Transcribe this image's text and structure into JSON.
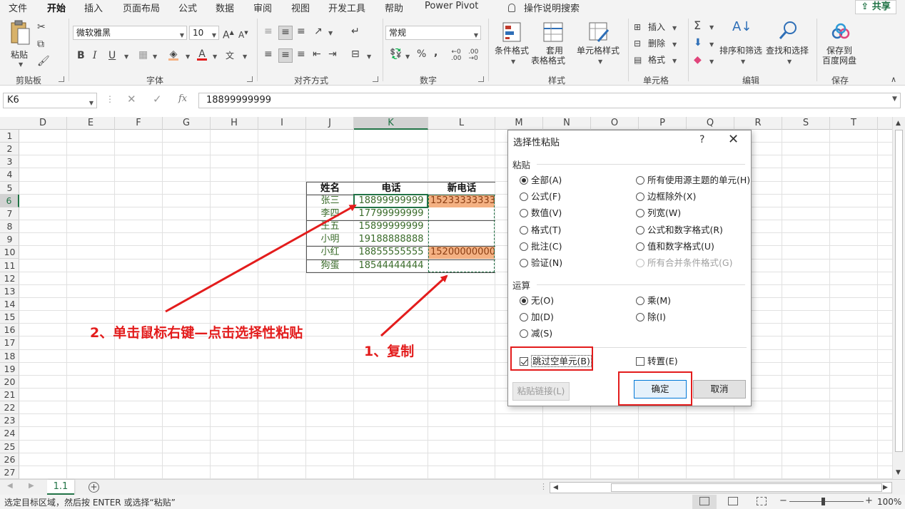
{
  "menu": {
    "tabs": [
      "文件",
      "开始",
      "插入",
      "页面布局",
      "公式",
      "数据",
      "审阅",
      "视图",
      "开发工具",
      "帮助",
      "Power Pivot"
    ],
    "active_tab": "开始",
    "tell_me": "操作说明搜索",
    "share": "共享"
  },
  "ribbon": {
    "clipboard": {
      "label": "剪贴板",
      "paste": "粘贴"
    },
    "font": {
      "label": "字体",
      "font_name": "微软雅黑",
      "font_size": "10"
    },
    "alignment": {
      "label": "对齐方式"
    },
    "number": {
      "label": "数字",
      "format": "常规"
    },
    "styles": {
      "label": "样式",
      "conditional_format": "条件格式",
      "table_format_line1": "套用",
      "table_format_line2": "表格格式",
      "cell_styles": "单元格样式"
    },
    "cells": {
      "label": "单元格",
      "insert": "插入",
      "delete": "删除",
      "format": "格式"
    },
    "editing": {
      "label": "编辑",
      "sort_filter": "排序和筛选",
      "find_select": "查找和选择"
    },
    "save": {
      "label": "保存",
      "save_line1": "保存到",
      "save_line2": "百度网盘"
    }
  },
  "formula_bar": {
    "name_box": "K6",
    "fx": "fx",
    "value": "18899999999"
  },
  "grid": {
    "columns": [
      "D",
      "E",
      "F",
      "G",
      "H",
      "I",
      "J",
      "K",
      "L",
      "M",
      "N",
      "O",
      "P",
      "Q",
      "R",
      "S",
      "T"
    ],
    "selected_column": "K",
    "rows": [
      "1",
      "2",
      "3",
      "4",
      "5",
      "6",
      "7",
      "8",
      "9",
      "10",
      "11",
      "12",
      "13",
      "14",
      "15",
      "16",
      "17",
      "18",
      "19",
      "20",
      "21",
      "22",
      "23",
      "24",
      "25",
      "26",
      "27"
    ],
    "selected_row": "6"
  },
  "table": {
    "headers": [
      "姓名",
      "电话",
      "新电话"
    ],
    "rows": [
      {
        "name": "张三",
        "phone": "18899999999",
        "new_phone": "15233333333"
      },
      {
        "name": "李四",
        "phone": "17799999999",
        "new_phone": ""
      },
      {
        "name": "王五",
        "phone": "15899999999",
        "new_phone": ""
      },
      {
        "name": "小明",
        "phone": "19188888888",
        "new_phone": ""
      },
      {
        "name": "小红",
        "phone": "18855555555",
        "new_phone": "15200000000"
      },
      {
        "name": "狗蛋",
        "phone": "18544444444",
        "new_phone": ""
      }
    ]
  },
  "annotations": {
    "step1": "1、复制",
    "step2": "2、单击鼠标右键—点击选择性粘贴",
    "colors": {
      "annotation": "#e31c1c",
      "highlight_fill": "#f4b183",
      "accent": "#217346"
    }
  },
  "dialog": {
    "title": "选择性粘贴",
    "help": "?",
    "close": "✕",
    "paste_section": "粘贴",
    "paste_options_left": [
      "全部(A)",
      "公式(F)",
      "数值(V)",
      "格式(T)",
      "批注(C)",
      "验证(N)"
    ],
    "paste_options_right": [
      "所有使用源主题的单元(H)",
      "边框除外(X)",
      "列宽(W)",
      "公式和数字格式(R)",
      "值和数字格式(U)",
      "所有合并条件格式(G)"
    ],
    "paste_selected": "全部(A)",
    "operation_section": "运算",
    "operation_options_left": [
      "无(O)",
      "加(D)",
      "减(S)"
    ],
    "operation_options_right": [
      "乘(M)",
      "除(I)"
    ],
    "operation_selected": "无(O)",
    "skip_blanks": "跳过空单元(B)",
    "skip_blanks_checked": true,
    "transpose": "转置(E)",
    "transpose_checked": false,
    "paste_link": "粘贴链接(L)",
    "ok": "确定",
    "cancel": "取消"
  },
  "sheet": {
    "tab": "1.1",
    "add": "+"
  },
  "status": {
    "message": "选定目标区域，然后按 ENTER 或选择“粘贴”",
    "zoom": "100%",
    "zoom_percent": 100
  }
}
